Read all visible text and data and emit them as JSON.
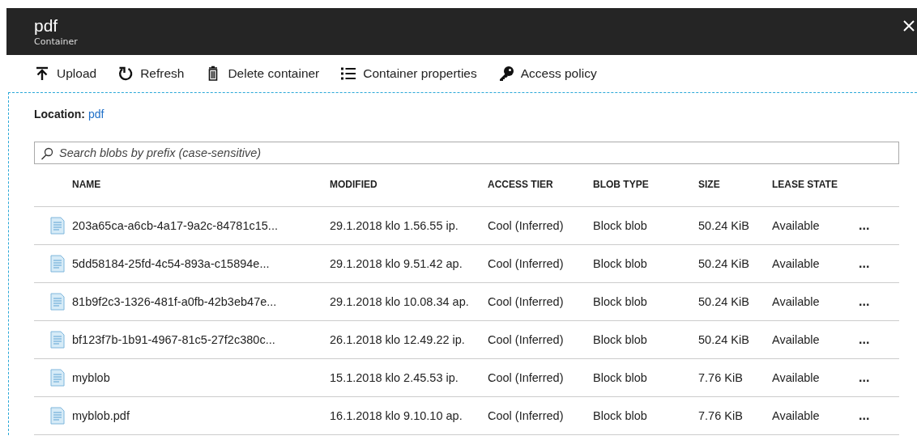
{
  "blade": {
    "title": "pdf",
    "subtitle": "Container"
  },
  "toolbar": [
    {
      "kind": "upload",
      "label": "Upload"
    },
    {
      "kind": "refresh",
      "label": "Refresh"
    },
    {
      "kind": "delete",
      "label": "Delete container"
    },
    {
      "kind": "properties",
      "label": "Container properties"
    },
    {
      "kind": "policy",
      "label": "Access policy"
    }
  ],
  "location": {
    "label": "Location:",
    "value": "pdf"
  },
  "search": {
    "placeholder": "Search blobs by prefix (case-sensitive)"
  },
  "table": {
    "columns": [
      "NAME",
      "MODIFIED",
      "ACCESS TIER",
      "BLOB TYPE",
      "SIZE",
      "LEASE STATE"
    ],
    "rows": [
      {
        "name": "203a65ca-a6cb-4a17-9a2c-84781c15...",
        "modified": "29.1.2018 klo 1.56.55 ip.",
        "access_tier": "Cool (Inferred)",
        "blob_type": "Block blob",
        "size": "50.24 KiB",
        "lease_state": "Available",
        "more": "..."
      },
      {
        "name": "5dd58184-25fd-4c54-893a-c15894e...",
        "modified": "29.1.2018 klo 9.51.42 ap.",
        "access_tier": "Cool (Inferred)",
        "blob_type": "Block blob",
        "size": "50.24 KiB",
        "lease_state": "Available",
        "more": "..."
      },
      {
        "name": "81b9f2c3-1326-481f-a0fb-42b3eb47e...",
        "modified": "29.1.2018 klo 10.08.34 ap.",
        "access_tier": "Cool (Inferred)",
        "blob_type": "Block blob",
        "size": "50.24 KiB",
        "lease_state": "Available",
        "more": "..."
      },
      {
        "name": "bf123f7b-1b91-4967-81c5-27f2c380c...",
        "modified": "26.1.2018 klo 12.49.22 ip.",
        "access_tier": "Cool (Inferred)",
        "blob_type": "Block blob",
        "size": "50.24 KiB",
        "lease_state": "Available",
        "more": "..."
      },
      {
        "name": "myblob",
        "modified": "15.1.2018 klo 2.45.53 ip.",
        "access_tier": "Cool (Inferred)",
        "blob_type": "Block blob",
        "size": "7.76 KiB",
        "lease_state": "Available",
        "more": "..."
      },
      {
        "name": "myblob.pdf",
        "modified": "16.1.2018 klo 9.10.10 ap.",
        "access_tier": "Cool (Inferred)",
        "blob_type": "Block blob",
        "size": "7.76 KiB",
        "lease_state": "Available",
        "more": "..."
      }
    ]
  }
}
